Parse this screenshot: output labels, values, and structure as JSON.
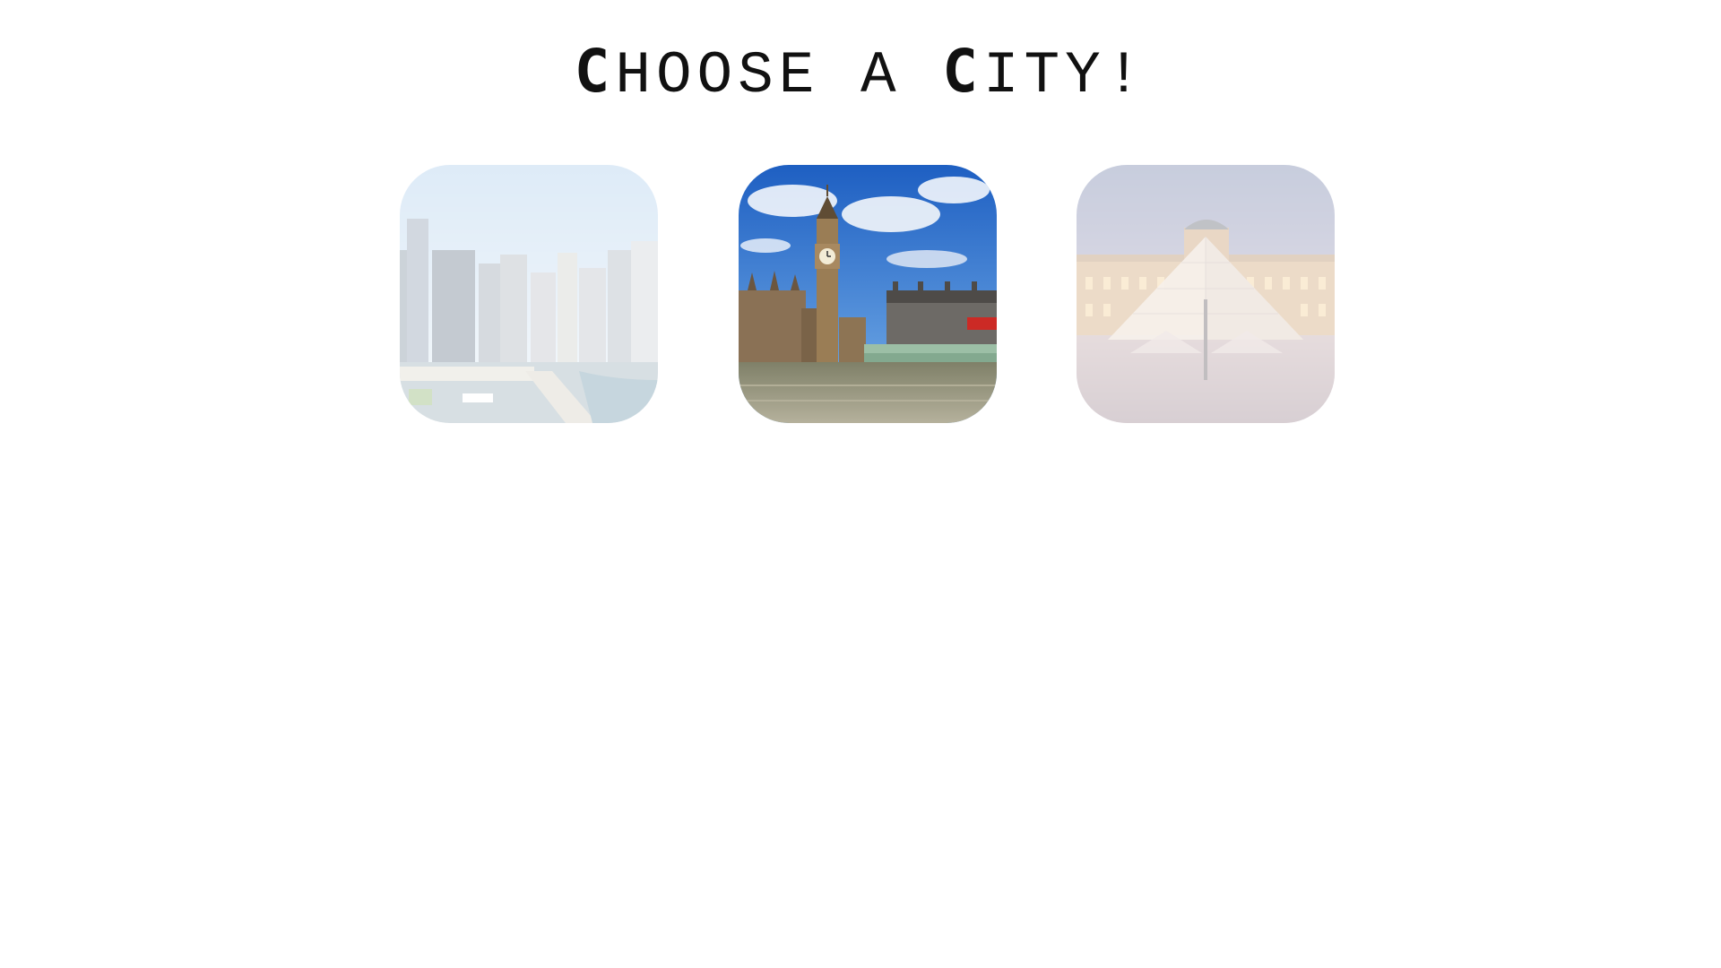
{
  "heading": {
    "parts": [
      {
        "text": "C",
        "emphasis": true
      },
      {
        "text": "hoose a ",
        "emphasis": false
      },
      {
        "text": "C",
        "emphasis": true
      },
      {
        "text": "ity!",
        "emphasis": false
      }
    ]
  },
  "cities": [
    {
      "id": "chicago",
      "icon": "chicago-skyline-photo",
      "selected": false
    },
    {
      "id": "london",
      "icon": "london-big-ben-photo",
      "selected": true
    },
    {
      "id": "paris",
      "icon": "paris-louvre-pyramid-photo",
      "selected": false
    }
  ],
  "colors": {
    "background": "#ffffff",
    "text": "#111111"
  }
}
